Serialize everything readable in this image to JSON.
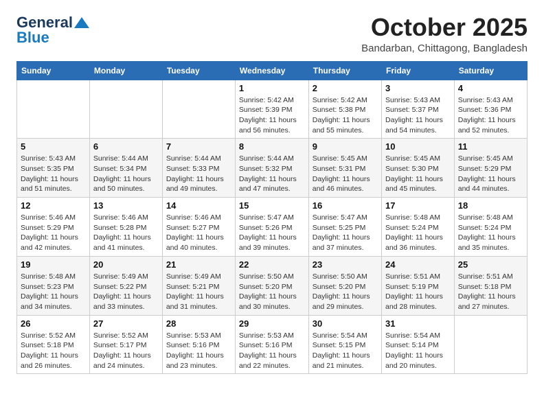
{
  "logo": {
    "line1": "General",
    "line2": "Blue"
  },
  "header": {
    "month": "October 2025",
    "location": "Bandarban, Chittagong, Bangladesh"
  },
  "weekdays": [
    "Sunday",
    "Monday",
    "Tuesday",
    "Wednesday",
    "Thursday",
    "Friday",
    "Saturday"
  ],
  "weeks": [
    [
      {
        "day": "",
        "info": ""
      },
      {
        "day": "",
        "info": ""
      },
      {
        "day": "",
        "info": ""
      },
      {
        "day": "1",
        "info": "Sunrise: 5:42 AM\nSunset: 5:39 PM\nDaylight: 11 hours\nand 56 minutes."
      },
      {
        "day": "2",
        "info": "Sunrise: 5:42 AM\nSunset: 5:38 PM\nDaylight: 11 hours\nand 55 minutes."
      },
      {
        "day": "3",
        "info": "Sunrise: 5:43 AM\nSunset: 5:37 PM\nDaylight: 11 hours\nand 54 minutes."
      },
      {
        "day": "4",
        "info": "Sunrise: 5:43 AM\nSunset: 5:36 PM\nDaylight: 11 hours\nand 52 minutes."
      }
    ],
    [
      {
        "day": "5",
        "info": "Sunrise: 5:43 AM\nSunset: 5:35 PM\nDaylight: 11 hours\nand 51 minutes."
      },
      {
        "day": "6",
        "info": "Sunrise: 5:44 AM\nSunset: 5:34 PM\nDaylight: 11 hours\nand 50 minutes."
      },
      {
        "day": "7",
        "info": "Sunrise: 5:44 AM\nSunset: 5:33 PM\nDaylight: 11 hours\nand 49 minutes."
      },
      {
        "day": "8",
        "info": "Sunrise: 5:44 AM\nSunset: 5:32 PM\nDaylight: 11 hours\nand 47 minutes."
      },
      {
        "day": "9",
        "info": "Sunrise: 5:45 AM\nSunset: 5:31 PM\nDaylight: 11 hours\nand 46 minutes."
      },
      {
        "day": "10",
        "info": "Sunrise: 5:45 AM\nSunset: 5:30 PM\nDaylight: 11 hours\nand 45 minutes."
      },
      {
        "day": "11",
        "info": "Sunrise: 5:45 AM\nSunset: 5:29 PM\nDaylight: 11 hours\nand 44 minutes."
      }
    ],
    [
      {
        "day": "12",
        "info": "Sunrise: 5:46 AM\nSunset: 5:29 PM\nDaylight: 11 hours\nand 42 minutes."
      },
      {
        "day": "13",
        "info": "Sunrise: 5:46 AM\nSunset: 5:28 PM\nDaylight: 11 hours\nand 41 minutes."
      },
      {
        "day": "14",
        "info": "Sunrise: 5:46 AM\nSunset: 5:27 PM\nDaylight: 11 hours\nand 40 minutes."
      },
      {
        "day": "15",
        "info": "Sunrise: 5:47 AM\nSunset: 5:26 PM\nDaylight: 11 hours\nand 39 minutes."
      },
      {
        "day": "16",
        "info": "Sunrise: 5:47 AM\nSunset: 5:25 PM\nDaylight: 11 hours\nand 37 minutes."
      },
      {
        "day": "17",
        "info": "Sunrise: 5:48 AM\nSunset: 5:24 PM\nDaylight: 11 hours\nand 36 minutes."
      },
      {
        "day": "18",
        "info": "Sunrise: 5:48 AM\nSunset: 5:24 PM\nDaylight: 11 hours\nand 35 minutes."
      }
    ],
    [
      {
        "day": "19",
        "info": "Sunrise: 5:48 AM\nSunset: 5:23 PM\nDaylight: 11 hours\nand 34 minutes."
      },
      {
        "day": "20",
        "info": "Sunrise: 5:49 AM\nSunset: 5:22 PM\nDaylight: 11 hours\nand 33 minutes."
      },
      {
        "day": "21",
        "info": "Sunrise: 5:49 AM\nSunset: 5:21 PM\nDaylight: 11 hours\nand 31 minutes."
      },
      {
        "day": "22",
        "info": "Sunrise: 5:50 AM\nSunset: 5:20 PM\nDaylight: 11 hours\nand 30 minutes."
      },
      {
        "day": "23",
        "info": "Sunrise: 5:50 AM\nSunset: 5:20 PM\nDaylight: 11 hours\nand 29 minutes."
      },
      {
        "day": "24",
        "info": "Sunrise: 5:51 AM\nSunset: 5:19 PM\nDaylight: 11 hours\nand 28 minutes."
      },
      {
        "day": "25",
        "info": "Sunrise: 5:51 AM\nSunset: 5:18 PM\nDaylight: 11 hours\nand 27 minutes."
      }
    ],
    [
      {
        "day": "26",
        "info": "Sunrise: 5:52 AM\nSunset: 5:18 PM\nDaylight: 11 hours\nand 26 minutes."
      },
      {
        "day": "27",
        "info": "Sunrise: 5:52 AM\nSunset: 5:17 PM\nDaylight: 11 hours\nand 24 minutes."
      },
      {
        "day": "28",
        "info": "Sunrise: 5:53 AM\nSunset: 5:16 PM\nDaylight: 11 hours\nand 23 minutes."
      },
      {
        "day": "29",
        "info": "Sunrise: 5:53 AM\nSunset: 5:16 PM\nDaylight: 11 hours\nand 22 minutes."
      },
      {
        "day": "30",
        "info": "Sunrise: 5:54 AM\nSunset: 5:15 PM\nDaylight: 11 hours\nand 21 minutes."
      },
      {
        "day": "31",
        "info": "Sunrise: 5:54 AM\nSunset: 5:14 PM\nDaylight: 11 hours\nand 20 minutes."
      },
      {
        "day": "",
        "info": ""
      }
    ]
  ]
}
